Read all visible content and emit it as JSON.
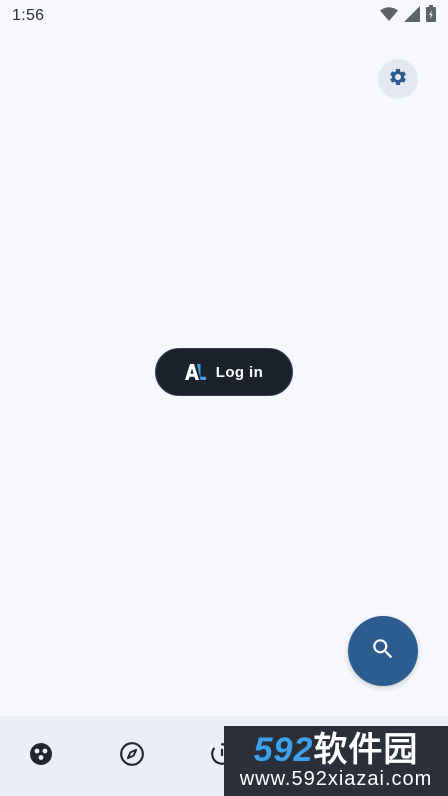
{
  "status_bar": {
    "time": "1:56",
    "icons": [
      "wifi-icon",
      "signal-icon",
      "battery-icon"
    ]
  },
  "header": {
    "settings_icon": "gear-icon"
  },
  "login": {
    "label": "Log in",
    "logo": "AL"
  },
  "fab": {
    "icon": "search-icon"
  },
  "bottom_nav": {
    "items": [
      {
        "icon": "profile-icon"
      },
      {
        "icon": "compass-icon"
      },
      {
        "icon": "timer-icon"
      }
    ]
  },
  "watermark": {
    "number": "592",
    "text": "软件园",
    "url": "www.592xiazai.com"
  },
  "colors": {
    "background": "#f7f8fc",
    "button_dark": "#1c222c",
    "fab": "#2d5d8f",
    "accent_blue": "#3ea2ea",
    "icon_blue": "#2d5d8f"
  }
}
